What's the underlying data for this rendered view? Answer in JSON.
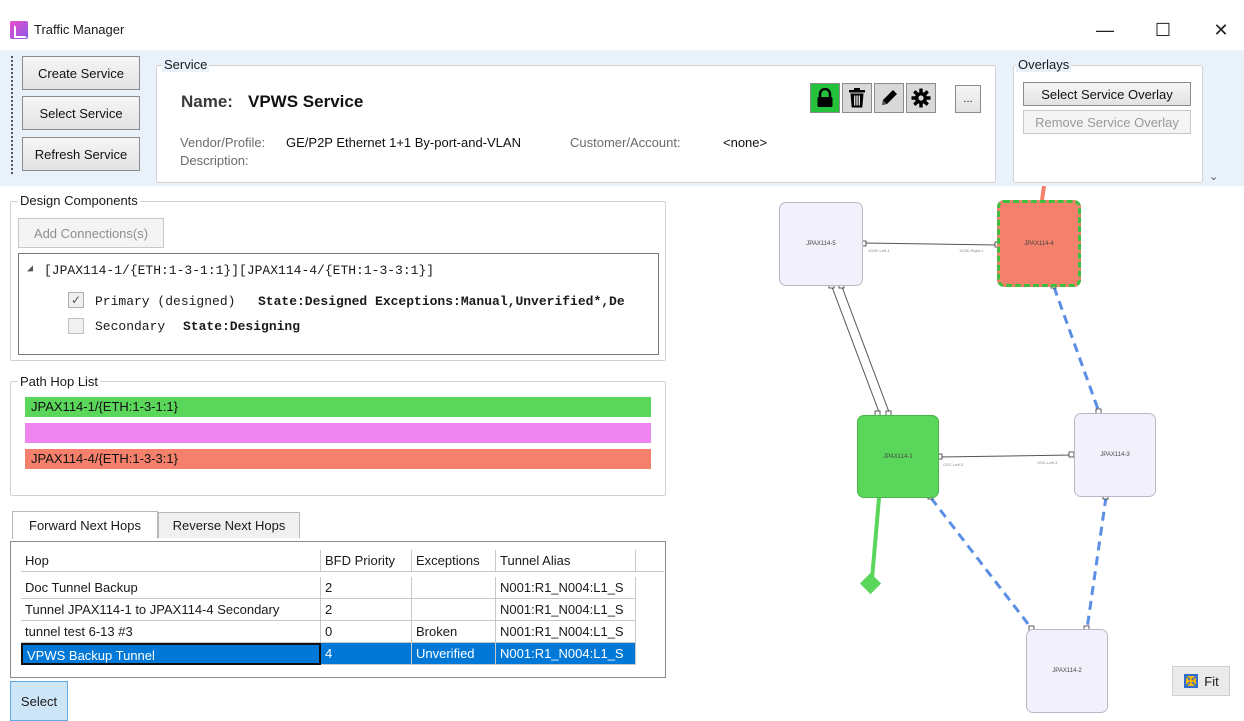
{
  "window": {
    "title": "Traffic Manager",
    "minimize": "—",
    "maximize": "☐",
    "close": "✕"
  },
  "toolbar": {
    "create_service": "Create Service",
    "select_service": "Select Service",
    "refresh_service": "Refresh Service",
    "more_label": "...",
    "overflow": "⌄"
  },
  "service": {
    "group_label": "Service",
    "name_label": "Name:",
    "name_value": "VPWS Service",
    "vendor_profile_label": "Vendor/Profile:",
    "vendor_profile_value": "GE/P2P Ethernet 1+1 By-port-and-VLAN",
    "customer_label": "Customer/Account:",
    "customer_value": "<none>",
    "description_label": "Description:"
  },
  "overlays": {
    "group_label": "Overlays",
    "select_overlay": "Select Service Overlay",
    "remove_overlay": "Remove Service Overlay"
  },
  "design_components": {
    "group_label": "Design Components",
    "add_connections": "Add Connections(s)",
    "tree_root": "[JPAX114-1/{ETH:1-3-1:1}][JPAX114-4/{ETH:1-3-3:1}]",
    "primary_label": "Primary (designed)",
    "primary_state": "State:Designed Exceptions:Manual,Unverified*,De",
    "primary_checked": true,
    "secondary_label": "Secondary",
    "secondary_state": "State:Designing",
    "secondary_checked": false
  },
  "path_hop_list": {
    "group_label": "Path Hop List",
    "hops": [
      {
        "label": "JPAX114-1/{ETH:1-3-1:1}",
        "color": "#5ad65a"
      },
      {
        "label": "",
        "color": "#ef86ef"
      },
      {
        "label": "JPAX114-4/{ETH:1-3-3:1}",
        "color": "#f5806c"
      }
    ]
  },
  "tabs": {
    "forward": "Forward Next Hops",
    "reverse": "Reverse Next Hops"
  },
  "next_hops": {
    "columns": [
      "Hop",
      "BFD Priority",
      "Exceptions",
      "Tunnel Alias"
    ],
    "rows": [
      {
        "hop": "Doc Tunnel Backup",
        "bfd": "2",
        "exceptions": "",
        "alias": "N001:R1_N004:L1_S"
      },
      {
        "hop": "Tunnel JPAX114-1 to JPAX114-4 Secondary",
        "bfd": "2",
        "exceptions": "",
        "alias": "N001:R1_N004:L1_S"
      },
      {
        "hop": "tunnel test 6-13 #3",
        "bfd": "0",
        "exceptions": "Broken",
        "alias": "N001:R1_N004:L1_S"
      },
      {
        "hop": "VPWS Backup Tunnel",
        "bfd": "4",
        "exceptions": "Unverified",
        "alias": "N001:R1_N004:L1_S"
      }
    ],
    "selected_row": 3
  },
  "select_button": "Select",
  "diagram": {
    "nodes": [
      {
        "id": "JPAX114-5",
        "label": "JPAX114-5"
      },
      {
        "id": "JPAX114-4",
        "label": "JPAX114-4"
      },
      {
        "id": "JPAX114-1",
        "label": "JPAX114-1"
      },
      {
        "id": "JPAX114-3",
        "label": "JPAX114-3"
      },
      {
        "id": "JPAX114-2",
        "label": "JPAX114-2"
      }
    ],
    "colors": {
      "source": "#5ad65a",
      "destination": "#f5806c",
      "neutral": "#f2f1fb",
      "protect_link": "#5b8fe6"
    },
    "fit_label": "Fit"
  }
}
